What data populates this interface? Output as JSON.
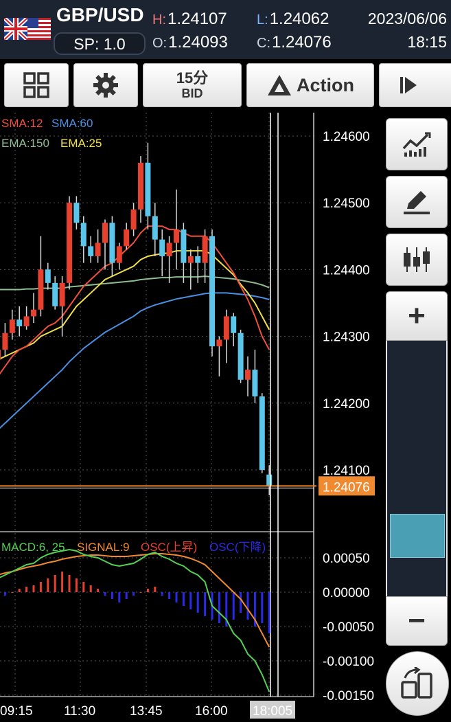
{
  "header": {
    "pair": "GBP/USD",
    "spread": "SP: 1.0",
    "high_label": "H:",
    "high": "1.24107",
    "low_label": "L:",
    "low": "1.24062",
    "open_label": "O:",
    "open": "1.24093",
    "close_label": "C:",
    "close": "1.24076",
    "date": "2023/06/06",
    "time": "18:15"
  },
  "toolbar": {
    "timeframe": "15分",
    "price_type": "BID",
    "action_label": "Action",
    "icons": [
      "grid-icon",
      "gear-icon",
      "warning-triangle-icon",
      "play-step-icon"
    ]
  },
  "sidebar": {
    "icons": [
      "line-chart-icon",
      "pen-icon",
      "candlestick-icon",
      "rotate-screen-icon"
    ],
    "zoom_in_label": "+",
    "zoom_out_label": "−",
    "zoom_level": 0.17
  },
  "colors": {
    "bull": "#e8402f",
    "bear": "#5cc6ea",
    "sma12": "#f0503c",
    "sma60": "#4a90e2",
    "ema150": "#8fbc8f",
    "ema25": "#f2e04a",
    "price_line": "#f08a30",
    "macd": "#52d152",
    "signal": "#f08a30",
    "osc_up": "#e8402f",
    "osc_down": "#2a2ae8"
  },
  "chart_data": [
    {
      "type": "candlestick",
      "legend": [
        "SMA:12",
        "SMA:60",
        "EMA:150",
        "EMA:25"
      ],
      "y_ticks": [
        "1.24600",
        "1.24500",
        "1.24400",
        "1.24300",
        "1.24200",
        "1.24100"
      ],
      "ylim": [
        1.2404,
        1.2462
      ],
      "current_price": "1.24076",
      "x_ticks": [
        "09:15",
        "11:30",
        "13:45",
        "16:00",
        "18:005"
      ],
      "candles": [
        {
          "o": 1.24265,
          "h": 1.2429,
          "l": 1.24255,
          "c": 1.2428
        },
        {
          "o": 1.2428,
          "h": 1.2432,
          "l": 1.2427,
          "c": 1.24305
        },
        {
          "o": 1.24305,
          "h": 1.2434,
          "l": 1.24295,
          "c": 1.24325
        },
        {
          "o": 1.24325,
          "h": 1.24345,
          "l": 1.243,
          "c": 1.24315
        },
        {
          "o": 1.24315,
          "h": 1.24345,
          "l": 1.2431,
          "c": 1.2433
        },
        {
          "o": 1.2433,
          "h": 1.24365,
          "l": 1.2432,
          "c": 1.2434
        },
        {
          "o": 1.2434,
          "h": 1.2445,
          "l": 1.2433,
          "c": 1.244
        },
        {
          "o": 1.244,
          "h": 1.2441,
          "l": 1.2437,
          "c": 1.2438
        },
        {
          "o": 1.2438,
          "h": 1.2439,
          "l": 1.2434,
          "c": 1.24345
        },
        {
          "o": 1.24345,
          "h": 1.2439,
          "l": 1.243,
          "c": 1.2438
        },
        {
          "o": 1.2438,
          "h": 1.2451,
          "l": 1.2437,
          "c": 1.245
        },
        {
          "o": 1.245,
          "h": 1.2451,
          "l": 1.2446,
          "c": 1.2447
        },
        {
          "o": 1.2447,
          "h": 1.2448,
          "l": 1.2441,
          "c": 1.24435
        },
        {
          "o": 1.24435,
          "h": 1.2445,
          "l": 1.2441,
          "c": 1.2442
        },
        {
          "o": 1.2442,
          "h": 1.2446,
          "l": 1.2441,
          "c": 1.2444
        },
        {
          "o": 1.2444,
          "h": 1.24475,
          "l": 1.244,
          "c": 1.2447
        },
        {
          "o": 1.2447,
          "h": 1.2448,
          "l": 1.2439,
          "c": 1.2441
        },
        {
          "o": 1.2441,
          "h": 1.2444,
          "l": 1.244,
          "c": 1.24435
        },
        {
          "o": 1.24435,
          "h": 1.2447,
          "l": 1.2443,
          "c": 1.2446
        },
        {
          "o": 1.2446,
          "h": 1.245,
          "l": 1.2445,
          "c": 1.2449
        },
        {
          "o": 1.2449,
          "h": 1.2457,
          "l": 1.2447,
          "c": 1.2456
        },
        {
          "o": 1.2456,
          "h": 1.2459,
          "l": 1.2446,
          "c": 1.2448
        },
        {
          "o": 1.2448,
          "h": 1.245,
          "l": 1.2442,
          "c": 1.24445
        },
        {
          "o": 1.24445,
          "h": 1.2446,
          "l": 1.2439,
          "c": 1.2442
        },
        {
          "o": 1.2442,
          "h": 1.2445,
          "l": 1.2438,
          "c": 1.2444
        },
        {
          "o": 1.2444,
          "h": 1.2452,
          "l": 1.244,
          "c": 1.2446
        },
        {
          "o": 1.2446,
          "h": 1.2447,
          "l": 1.2438,
          "c": 1.2441
        },
        {
          "o": 1.2441,
          "h": 1.2443,
          "l": 1.2437,
          "c": 1.2442
        },
        {
          "o": 1.2442,
          "h": 1.24435,
          "l": 1.2438,
          "c": 1.2441
        },
        {
          "o": 1.2441,
          "h": 1.2446,
          "l": 1.2438,
          "c": 1.2445
        },
        {
          "o": 1.2445,
          "h": 1.2446,
          "l": 1.2427,
          "c": 1.24285
        },
        {
          "o": 1.24285,
          "h": 1.243,
          "l": 1.2424,
          "c": 1.24295
        },
        {
          "o": 1.24295,
          "h": 1.2434,
          "l": 1.2426,
          "c": 1.2433
        },
        {
          "o": 1.2433,
          "h": 1.24335,
          "l": 1.24285,
          "c": 1.24305
        },
        {
          "o": 1.24305,
          "h": 1.2431,
          "l": 1.2423,
          "c": 1.24235
        },
        {
          "o": 1.24235,
          "h": 1.2427,
          "l": 1.2421,
          "c": 1.2425
        },
        {
          "o": 1.2425,
          "h": 1.2428,
          "l": 1.242,
          "c": 1.2421
        },
        {
          "o": 1.2421,
          "h": 1.24215,
          "l": 1.24095,
          "c": 1.241
        },
        {
          "o": 1.24093,
          "h": 1.24107,
          "l": 1.24062,
          "c": 1.24076
        }
      ],
      "sma12": [
        1.2424,
        1.24255,
        1.2427,
        1.2428,
        1.24285,
        1.24295,
        1.24305,
        1.24315,
        1.2432,
        1.2433,
        1.24345,
        1.2436,
        1.24375,
        1.24385,
        1.24395,
        1.24405,
        1.2441,
        1.2442,
        1.2443,
        1.2444,
        1.24455,
        1.24465,
        1.24465,
        1.24465,
        1.2446,
        1.2446,
        1.24455,
        1.2445,
        1.2445,
        1.2445,
        1.2444,
        1.24425,
        1.2441,
        1.24395,
        1.24375,
        1.24355,
        1.2433,
        1.243,
        1.2428
      ],
      "ema25": [
        1.24265,
        1.2427,
        1.24275,
        1.2428,
        1.24285,
        1.2429,
        1.243,
        1.24305,
        1.2431,
        1.24315,
        1.2433,
        1.24345,
        1.24355,
        1.24365,
        1.24375,
        1.24385,
        1.2439,
        1.24395,
        1.244,
        1.24405,
        1.24415,
        1.2442,
        1.24422,
        1.24424,
        1.24425,
        1.24428,
        1.24428,
        1.24428,
        1.24428,
        1.24428,
        1.24422,
        1.24412,
        1.24402,
        1.24392,
        1.24378,
        1.24365,
        1.2435,
        1.2433,
        1.2431
      ],
      "ema150": [
        1.2437,
        1.2437,
        1.2437,
        1.2437,
        1.24371,
        1.24371,
        1.24372,
        1.24372,
        1.24372,
        1.24372,
        1.24374,
        1.24375,
        1.24376,
        1.24377,
        1.24378,
        1.24379,
        1.2438,
        1.24381,
        1.24382,
        1.24383,
        1.24385,
        1.24386,
        1.24387,
        1.24388,
        1.24388,
        1.24389,
        1.24389,
        1.24389,
        1.24389,
        1.2439,
        1.24389,
        1.24388,
        1.24387,
        1.24386,
        1.24384,
        1.24382,
        1.2438,
        1.24377,
        1.24373
      ],
      "sma60": [
        1.2416,
        1.2417,
        1.2418,
        1.2419,
        1.242,
        1.2421,
        1.2422,
        1.2423,
        1.2424,
        1.2425,
        1.24262,
        1.24272,
        1.24282,
        1.2429,
        1.24298,
        1.24306,
        1.24312,
        1.24318,
        1.24324,
        1.2433,
        1.24338,
        1.24343,
        1.24347,
        1.2435,
        1.24353,
        1.24356,
        1.24358,
        1.2436,
        1.24362,
        1.24364,
        1.24365,
        1.24365,
        1.24365,
        1.24364,
        1.24363,
        1.24362,
        1.2436,
        1.24358,
        1.24355
      ]
    },
    {
      "type": "bar",
      "legend": [
        "MACD:6, 25",
        "SIGNAL:9",
        "OSC(上昇)",
        "OSC(下降)"
      ],
      "y_ticks": [
        "0.00050",
        "0.00000",
        "-0.00050",
        "-0.00100",
        "-0.00150"
      ],
      "ylim": [
        -0.0016,
        0.0007
      ],
      "osc": [
        -0.0001,
        -5e-05,
        0.0,
        5e-05,
        8e-05,
        0.0001,
        0.00015,
        0.0002,
        0.00025,
        0.0003,
        0.00025,
        0.0002,
        0.00015,
        0.0001,
        5e-05,
        -5e-05,
        -0.0001,
        -0.00015,
        -0.0001,
        -5e-05,
        0.0,
        5e-05,
        8e-05,
        -5e-05,
        -0.0001,
        -0.00015,
        -0.0002,
        -0.00025,
        -0.0003,
        -0.00035,
        -0.0004,
        -0.00045,
        -0.0005,
        -0.0004,
        -0.0003,
        -0.0004,
        -0.0005,
        -0.00045,
        -0.0006
      ],
      "macd": [
        0.0002,
        0.00025,
        0.0003,
        0.00035,
        0.0004,
        0.00042,
        0.0005,
        0.00055,
        0.00058,
        0.0006,
        0.00062,
        0.0006,
        0.00055,
        0.00052,
        0.0005,
        0.00045,
        0.0004,
        0.00038,
        0.0004,
        0.00042,
        0.00048,
        0.00055,
        0.00058,
        0.00052,
        0.00048,
        0.00042,
        0.00038,
        0.0003,
        0.00025,
        0.00015,
        -0.0002,
        -0.0003,
        -0.0004,
        -0.0006,
        -0.0007,
        -0.0009,
        -0.001,
        -0.0012,
        -0.00145
      ],
      "signal": [
        0.00025,
        0.00028,
        0.0003,
        0.00033,
        0.00036,
        0.00038,
        0.0004,
        0.00043,
        0.00045,
        0.00048,
        0.0005,
        0.00052,
        0.00053,
        0.00054,
        0.00054,
        0.00053,
        0.00052,
        0.00052,
        0.00052,
        0.00053,
        0.00054,
        0.00055,
        0.00056,
        0.00056,
        0.00055,
        0.00054,
        0.00052,
        0.00049,
        0.00045,
        0.0004,
        0.0003,
        0.0002,
        0.0001,
        0.0,
        -0.0001,
        -0.00025,
        -0.0004,
        -0.0006,
        -0.0008
      ]
    }
  ]
}
